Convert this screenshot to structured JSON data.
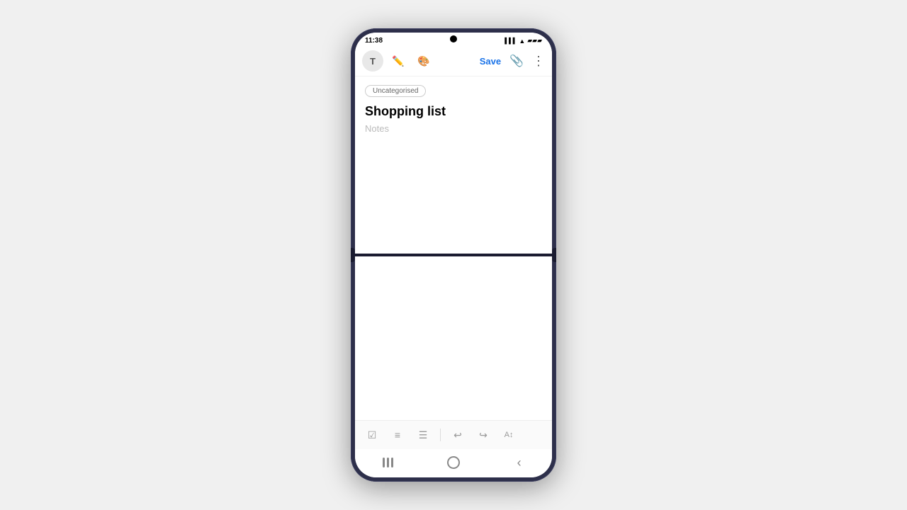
{
  "phone": {
    "status_bar": {
      "time": "11:38",
      "signal_icon": "📶",
      "wifi_icon": "WiFi",
      "battery_icon": "🔋"
    },
    "toolbar": {
      "text_btn_label": "T",
      "pen_btn_label": "✏",
      "palette_btn_label": "🎨",
      "save_label": "Save",
      "attach_icon": "📎",
      "more_icon": "⋮"
    },
    "note": {
      "category": "Uncategorised",
      "title": "Shopping list",
      "placeholder": "Notes"
    },
    "bottom_toolbar": {
      "checkbox_icon": "☑",
      "list_icon": "≡",
      "list2_icon": "☰",
      "undo_icon": "↩",
      "redo_icon": "↪",
      "text_size_icon": "A↕"
    },
    "nav_bar": {
      "recent_label": "|||",
      "home_label": "○",
      "back_label": "‹"
    }
  }
}
